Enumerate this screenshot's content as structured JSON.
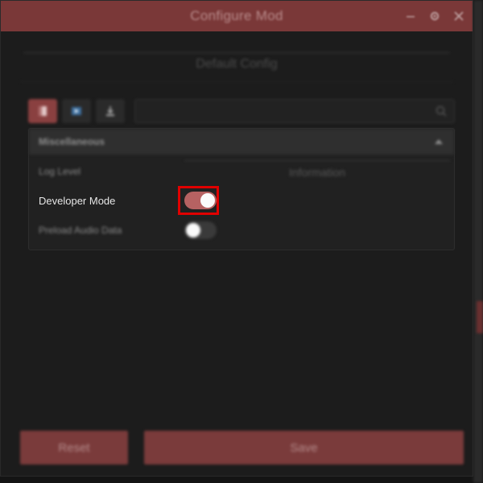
{
  "window": {
    "title": "Configure Mod"
  },
  "config": {
    "section_title": "Default Config"
  },
  "toolbar": {
    "buttons": [
      {
        "icon": "file-icon",
        "active": true
      },
      {
        "icon": "play-icon",
        "active": false
      },
      {
        "icon": "download-icon",
        "active": false
      }
    ],
    "search_placeholder": ""
  },
  "panel": {
    "header": "Miscellaneous",
    "settings": [
      {
        "label": "Log Level",
        "value": "Information"
      },
      {
        "label": "Developer Mode",
        "enabled": true
      },
      {
        "label": "Preload Audio Data",
        "enabled": false
      }
    ]
  },
  "footer": {
    "reset_label": "Reset",
    "save_label": "Save"
  },
  "colors": {
    "accent": "#7a3838",
    "toggle_on": "#b66262",
    "highlight": "#e00000"
  }
}
